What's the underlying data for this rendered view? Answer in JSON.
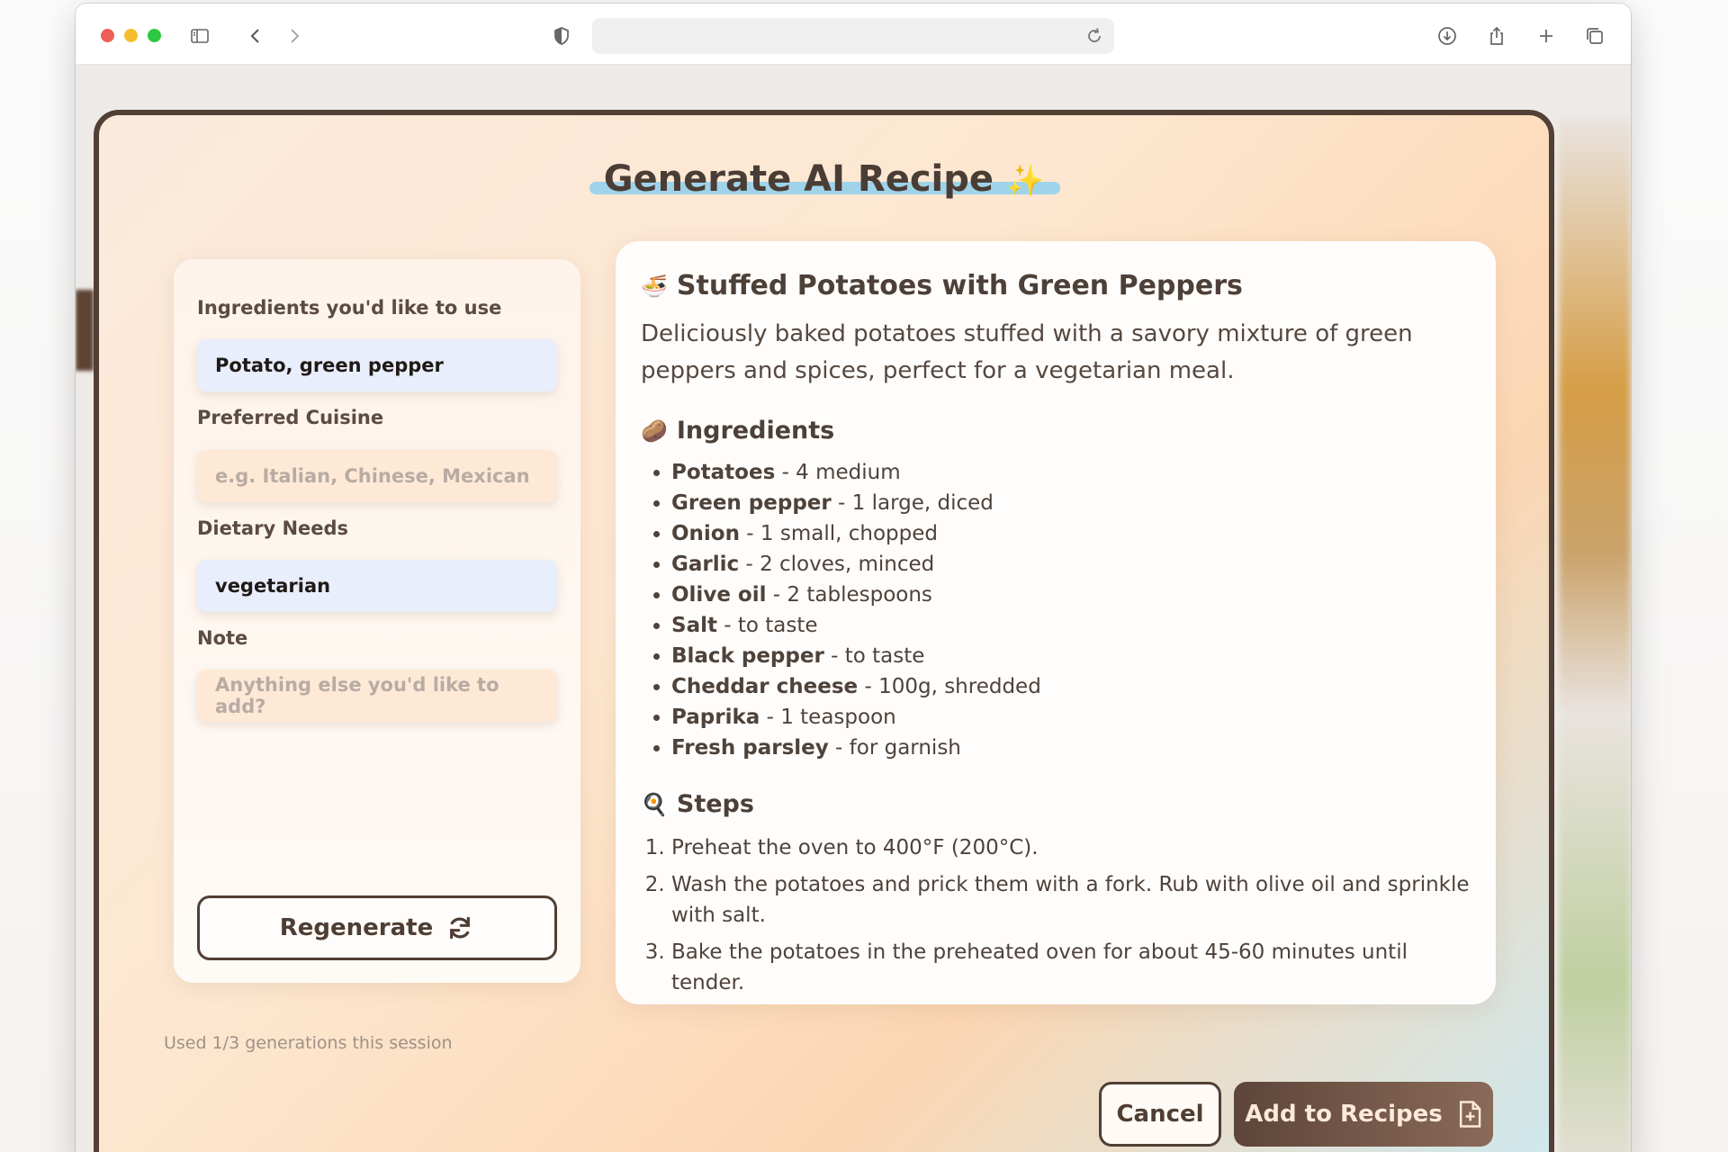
{
  "browser": {
    "address": "",
    "icons": [
      "sidebar-icon",
      "back-icon",
      "forward-icon",
      "shield-icon",
      "reload-icon",
      "download-icon",
      "share-icon",
      "new-tab-icon",
      "tabs-overview-icon"
    ]
  },
  "modal": {
    "title": "Generate AI Recipe",
    "title_sparkle": "✨",
    "accent_underline_color": "#9fd3ea"
  },
  "form": {
    "ingredients": {
      "label": "Ingredients you'd like to use",
      "value": "Potato, green pepper"
    },
    "cuisine": {
      "label": "Preferred Cuisine",
      "placeholder": "e.g. Italian, Chinese, Mexican"
    },
    "dietary": {
      "label": "Dietary Needs",
      "value": "vegetarian"
    },
    "note": {
      "label": "Note",
      "placeholder": "Anything else you'd like to add?"
    },
    "regenerate_label": "Regenerate",
    "usage_text": "Used 1/3 generations this session"
  },
  "recipe": {
    "title_emoji": "🍜",
    "title": "Stuffed Potatoes with Green Peppers",
    "description": "Deliciously baked potatoes stuffed with a savory mixture of green peppers and spices, perfect for a vegetarian meal.",
    "ingredients_heading": "Ingredients",
    "ingredients_emoji": "🥔",
    "ingredients": [
      {
        "name": "Potatoes",
        "detail": " - 4 medium"
      },
      {
        "name": "Green pepper",
        "detail": " - 1 large, diced"
      },
      {
        "name": "Onion",
        "detail": " - 1 small, chopped"
      },
      {
        "name": "Garlic",
        "detail": " - 2 cloves, minced"
      },
      {
        "name": "Olive oil",
        "detail": " - 2 tablespoons"
      },
      {
        "name": "Salt",
        "detail": " - to taste"
      },
      {
        "name": "Black pepper",
        "detail": " - to taste"
      },
      {
        "name": "Cheddar cheese",
        "detail": " - 100g, shredded"
      },
      {
        "name": "Paprika",
        "detail": " - 1 teaspoon"
      },
      {
        "name": "Fresh parsley",
        "detail": " - for garnish"
      }
    ],
    "steps_heading": "Steps",
    "steps_emoji": "🍳",
    "steps": [
      "Preheat the oven to 400°F (200°C).",
      "Wash the potatoes and prick them with a fork. Rub with olive oil and sprinkle with salt.",
      "Bake the potatoes in the preheated oven for about 45-60 minutes until tender."
    ]
  },
  "actions": {
    "cancel_label": "Cancel",
    "add_label": "Add to Recipes"
  }
}
